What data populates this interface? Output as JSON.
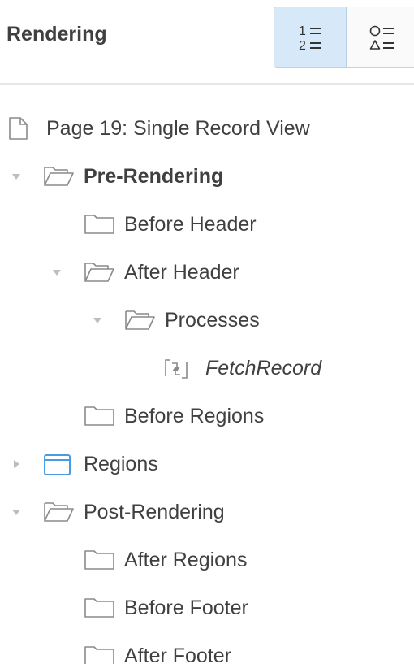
{
  "header": {
    "title": "Rendering",
    "toggle_sequence_label": "1 =\n2 =",
    "toggle_shapes_label": "○ =\n△ ="
  },
  "tree": [
    {
      "label": "Page 19: Single Record View",
      "icon": "page-icon",
      "twisty": "none",
      "level": 0
    },
    {
      "label": "Pre-Rendering",
      "icon": "folder-open-icon",
      "twisty": "expanded",
      "level": 0,
      "bold": true
    },
    {
      "label": "Before Header",
      "icon": "folder-closed-icon",
      "twisty": "none",
      "level": 1
    },
    {
      "label": "After Header",
      "icon": "folder-open-icon",
      "twisty": "expanded",
      "level": 1
    },
    {
      "label": "Processes",
      "icon": "folder-open-icon",
      "twisty": "expanded",
      "level": 2
    },
    {
      "label": "FetchRecord",
      "icon": "process-icon",
      "twisty": "none",
      "level": 3,
      "italic": true
    },
    {
      "label": "Before Regions",
      "icon": "folder-closed-icon",
      "twisty": "none",
      "level": 1
    },
    {
      "label": "Regions",
      "icon": "region-icon",
      "twisty": "collapsed",
      "level": 0
    },
    {
      "label": "Post-Rendering",
      "icon": "folder-open-icon",
      "twisty": "expanded",
      "level": 0
    },
    {
      "label": "After Regions",
      "icon": "folder-closed-icon",
      "twisty": "none",
      "level": 1
    },
    {
      "label": "Before Footer",
      "icon": "folder-closed-icon",
      "twisty": "none",
      "level": 1
    },
    {
      "label": "After Footer",
      "icon": "folder-closed-icon",
      "twisty": "none",
      "level": 1
    }
  ],
  "colors": {
    "toggle_active": "#d7e9f9",
    "region_icon": "#4a9be0",
    "text": "#404040",
    "icon_stroke": "#8a8a8a",
    "twisty": "#bdbdbd"
  }
}
